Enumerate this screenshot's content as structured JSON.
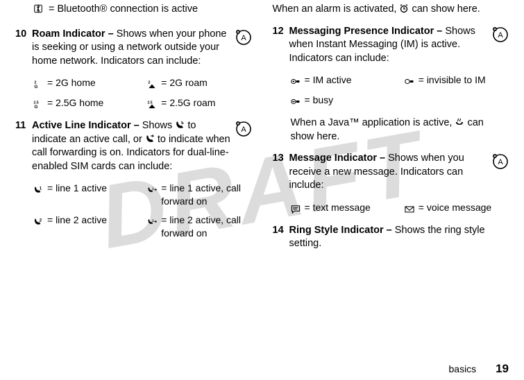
{
  "watermark": "DRAFT",
  "left": {
    "bluetooth_line": "= Bluetooth® connection is active",
    "item10": {
      "num": "10",
      "title": "Roam Indicator –",
      "desc": "Shows when your phone is seeking or using a network outside your home network. Indicators can include:",
      "cells": {
        "a": "= 2G home",
        "b": "= 2G roam",
        "c": "= 2.5G home",
        "d": "= 2.5G roam"
      }
    },
    "item11": {
      "num": "11",
      "title": "Active Line Indicator –",
      "desc_a": "Shows ",
      "desc_b": " to indicate an active call, or ",
      "desc_c": " to indicate when call forwarding is on. Indicators for dual-line-enabled SIM cards can include:",
      "cells": {
        "a": "= line 1 active",
        "b": "= line 1 active, call forward on",
        "c": "= line 2 active",
        "d": "= line 2 active, call forward on"
      }
    }
  },
  "right": {
    "alarm_a": "When an alarm is activated, ",
    "alarm_b": " can show here.",
    "item12": {
      "num": "12",
      "title": "Messaging Presence Indicator –",
      "desc": "Shows when Instant Messaging (IM) is active. Indicators can include:",
      "cells": {
        "a": "= IM active",
        "b": "= invisible to IM",
        "c": "= busy"
      }
    },
    "java_a": "When a Java™ application is active, ",
    "java_b": " can show here.",
    "item13": {
      "num": "13",
      "title": "Message Indicator –",
      "desc": "Shows when you receive a new message. Indicators can include:",
      "cells": {
        "a": "= text message",
        "b": "= voice message"
      }
    },
    "item14": {
      "num": "14",
      "title": "Ring Style Indicator –",
      "desc": "Shows the ring style setting."
    }
  },
  "footer": {
    "section": "basics",
    "page": "19"
  }
}
